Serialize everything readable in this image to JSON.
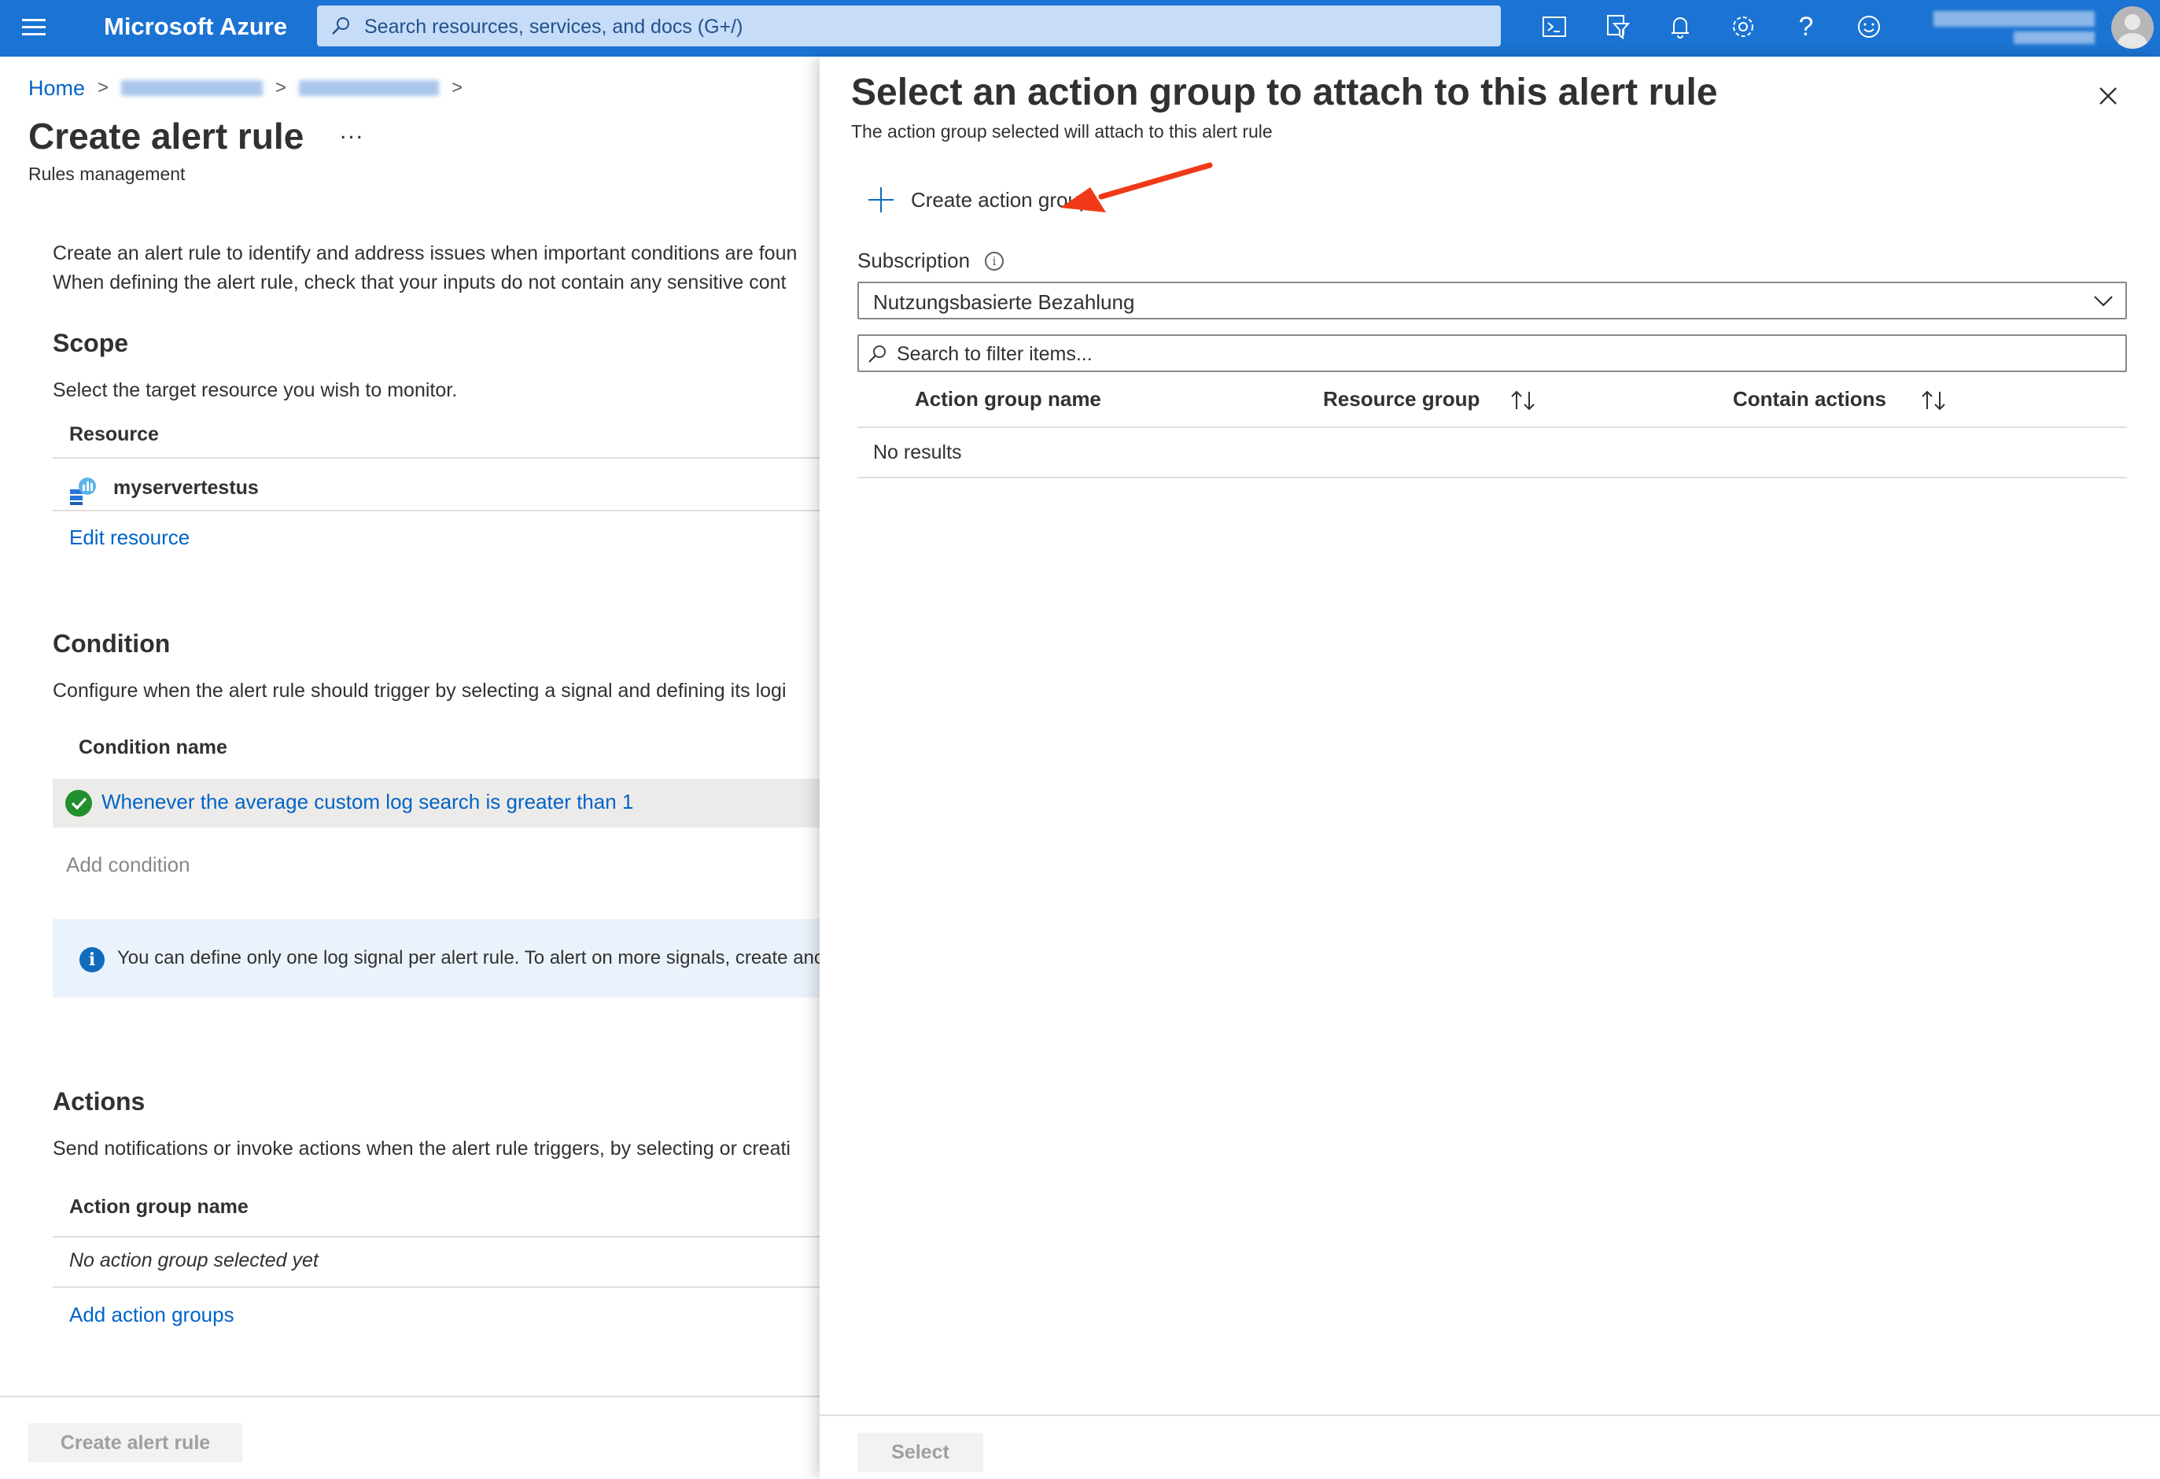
{
  "topbar": {
    "brand": "Microsoft Azure",
    "search_placeholder": "Search resources, services, and docs (G+/)",
    "icons": [
      "cloud-shell-icon",
      "directory-filter-icon",
      "notifications-icon",
      "settings-icon",
      "help-icon",
      "feedback-icon"
    ],
    "help_glyph": "?"
  },
  "breadcrumb": {
    "home": "Home",
    "separator": ">"
  },
  "page": {
    "title": "Create alert rule",
    "more": "...",
    "subtitle": "Rules management",
    "intro_line1": "Create an alert rule to identify and address issues when important conditions are foun",
    "intro_line2": "When defining the alert rule, check that your inputs do not contain any sensitive cont"
  },
  "scope": {
    "heading": "Scope",
    "description": "Select the target resource you wish to monitor.",
    "column_header": "Resource",
    "resource_name": "myservertestus",
    "edit_link": "Edit resource"
  },
  "condition": {
    "heading": "Condition",
    "description": "Configure when the alert rule should trigger by selecting a signal and defining its logi",
    "column_header": "Condition name",
    "condition_link": "Whenever the average custom log search is greater than 1",
    "add_condition": "Add condition",
    "info_icon": "i",
    "info_text": "You can define only one log signal per alert rule. To alert on more signals, create anc"
  },
  "actions": {
    "heading": "Actions",
    "description": "Send notifications or invoke actions when the alert rule triggers, by selecting or creati",
    "column_header": "Action group name",
    "empty_text": "No action group selected yet",
    "add_link": "Add action groups"
  },
  "footer": {
    "create_button": "Create alert rule"
  },
  "blade": {
    "title": "Select an action group to attach to this alert rule",
    "subtitle": "The action group selected will attach to this alert rule",
    "create_action_group": "Create action group",
    "subscription_label": "Subscription",
    "subscription_info": "i",
    "subscription_value": "Nutzungsbasierte Bezahlung",
    "filter_placeholder": "Search to filter items...",
    "columns": [
      "Action group name",
      "Resource group",
      "Contain actions"
    ],
    "no_results": "No results",
    "select_button": "Select"
  },
  "colors": {
    "topbar": "#1b73d3",
    "link": "#0064c8",
    "success": "#218f2c",
    "annotation_arrow": "#f03a17"
  }
}
